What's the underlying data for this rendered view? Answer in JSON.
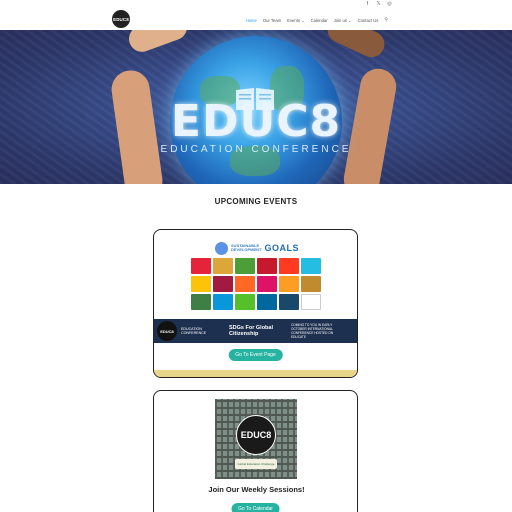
{
  "social": [
    "f",
    "𝕏",
    "◎"
  ],
  "logo": {
    "text": "EDUC8"
  },
  "nav": {
    "items": [
      {
        "label": "Home",
        "active": true
      },
      {
        "label": "Our Team",
        "active": false
      },
      {
        "label": "Events ⌄",
        "active": false
      },
      {
        "label": "Calendar",
        "active": false
      },
      {
        "label": "Join us ⌄",
        "active": false
      },
      {
        "label": "Contact Us",
        "active": false
      }
    ],
    "search_icon": "search-icon"
  },
  "hero": {
    "title": "EDUC8",
    "subtitle": "EDUCATION CONFERENCE"
  },
  "section": {
    "title": "UPCOMING EVENTS"
  },
  "event1": {
    "sdg_line1": "SUSTAINABLE",
    "sdg_line2": "DEVELOPMENT",
    "sdg_goals": "GOALS",
    "banner_logo": "EDUC8",
    "banner_left": "EDUCATION CONFERENCE",
    "banner_mid": "SDGs For Global Citizenship",
    "banner_right": "COMING TO YOU IN EARLY OCTOBER INTERNATIONAL CONFERENCE HOSTED ON EDUCATE",
    "button": "Go To Event Page"
  },
  "event2": {
    "image_logo": "EDUC8",
    "image_tag": "Global Education Challenge",
    "title": "Join Our Weekly Sessions!",
    "button": "Go To Calendar"
  },
  "colors": {
    "accent": "#26b3a2",
    "nav_active": "#2ea3f2"
  }
}
